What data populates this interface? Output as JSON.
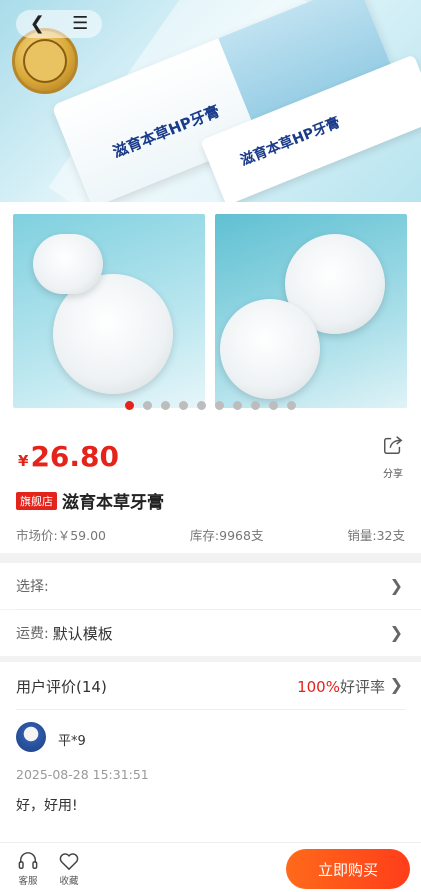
{
  "product": {
    "price_currency": "¥",
    "price": "26.80",
    "store_tag": "旗舰店",
    "title": "滋育本草牙膏",
    "market_price": "市场价:￥59.00",
    "stock": "库存:9968支",
    "sales": "销量:32支",
    "hero_label": "滋育本草HP牙膏"
  },
  "share": {
    "label": "分享"
  },
  "gallery": {
    "dot_count": 10,
    "active_index": 0
  },
  "options": {
    "select_label": "选择:",
    "shipping_label": "运费:",
    "shipping_value": "默认模板"
  },
  "reviews": {
    "heading": "用户评价(14)",
    "good_rate_value": "100%",
    "good_rate_label": "好评率",
    "items": [
      {
        "user": "平*9",
        "time": "2025-08-28 15:31:51",
        "text": "好，好用!"
      }
    ]
  },
  "bottom_bar": {
    "service_label": "客服",
    "favorite_label": "收藏",
    "buy_label": "立即购买"
  },
  "colors": {
    "accent": "#e4231a",
    "buy_gradient_start": "#ff6a1a",
    "buy_gradient_end": "#ff3d1a"
  }
}
